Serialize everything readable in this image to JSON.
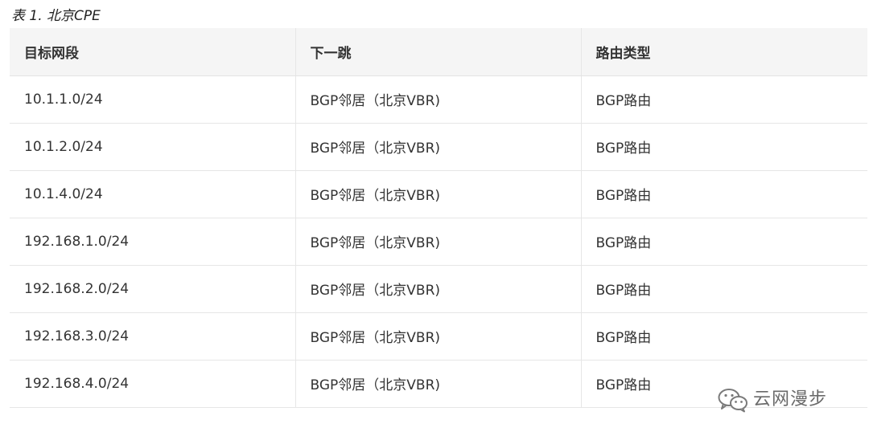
{
  "caption": "表 1. 北京CPE",
  "table": {
    "headers": [
      "目标网段",
      "下一跳",
      "路由类型"
    ],
    "rows": [
      [
        "10.1.1.0/24",
        "BGP邻居（北京VBR)",
        "BGP路由"
      ],
      [
        "10.1.2.0/24",
        "BGP邻居（北京VBR)",
        "BGP路由"
      ],
      [
        "10.1.4.0/24",
        "BGP邻居（北京VBR)",
        "BGP路由"
      ],
      [
        "192.168.1.0/24",
        "BGP邻居（北京VBR)",
        "BGP路由"
      ],
      [
        "192.168.2.0/24",
        "BGP邻居（北京VBR)",
        "BGP路由"
      ],
      [
        "192.168.3.0/24",
        "BGP邻居（北京VBR)",
        "BGP路由"
      ],
      [
        "192.168.4.0/24",
        "BGP邻居（北京VBR)",
        "BGP路由"
      ]
    ]
  },
  "watermark": {
    "icon": "wechat-icon",
    "text": "云网漫步"
  }
}
